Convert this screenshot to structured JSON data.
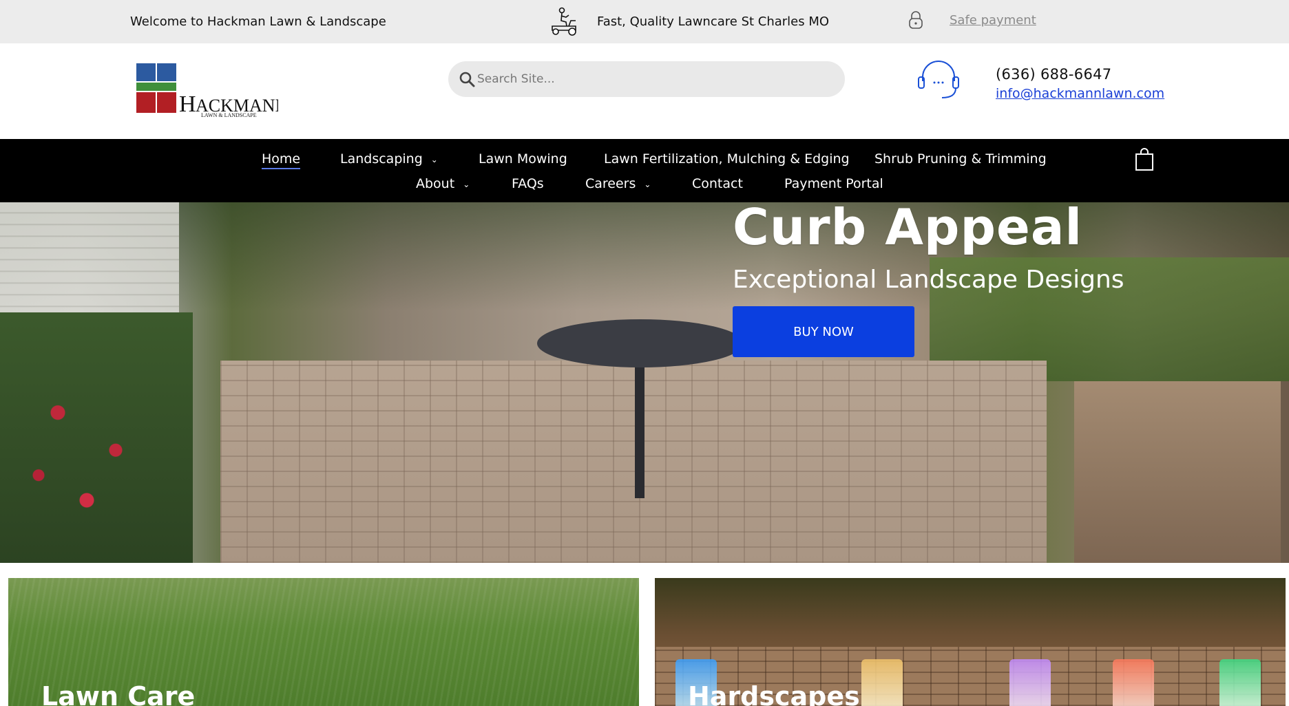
{
  "topbar": {
    "welcome": "Welcome to Hackman Lawn & Landscape",
    "tagline": "Fast, Quality Lawncare St Charles MO",
    "safe_payment": "Safe payment",
    "icons": [
      "mower-icon",
      "lock-icon"
    ]
  },
  "header": {
    "logo": {
      "name": "HACKMANN",
      "sub": "LAWN & LANDSCAPE",
      "colors": [
        "#2c5aa0",
        "#3f8f3b",
        "#b21f24"
      ]
    },
    "search_placeholder": "Search Site...",
    "phone": "(636) 688-6647",
    "email": "info@hackmannlawn.com"
  },
  "nav": {
    "row1": [
      {
        "label": "Home",
        "active": true,
        "dropdown": false
      },
      {
        "label": "Landscaping",
        "active": false,
        "dropdown": true
      },
      {
        "label": "Lawn Mowing",
        "active": false,
        "dropdown": false
      },
      {
        "label": "Lawn Fertilization, Mulching & Edging",
        "active": false,
        "dropdown": false
      },
      {
        "label": "Shrub Pruning & Trimming",
        "active": false,
        "dropdown": false
      }
    ],
    "row2": [
      {
        "label": "About",
        "dropdown": true
      },
      {
        "label": "FAQs",
        "dropdown": false
      },
      {
        "label": "Careers",
        "dropdown": true
      },
      {
        "label": "Contact",
        "dropdown": false
      },
      {
        "label": "Payment Portal",
        "dropdown": false
      }
    ],
    "chevron": "⌄"
  },
  "hero": {
    "title": "Curb Appeal",
    "subtitle": "Exceptional Landscape Designs",
    "button": "BUY NOW",
    "button_color": "#0b3fe0"
  },
  "cards": [
    {
      "title": "Lawn Care"
    },
    {
      "title": "Hardscapes"
    }
  ]
}
